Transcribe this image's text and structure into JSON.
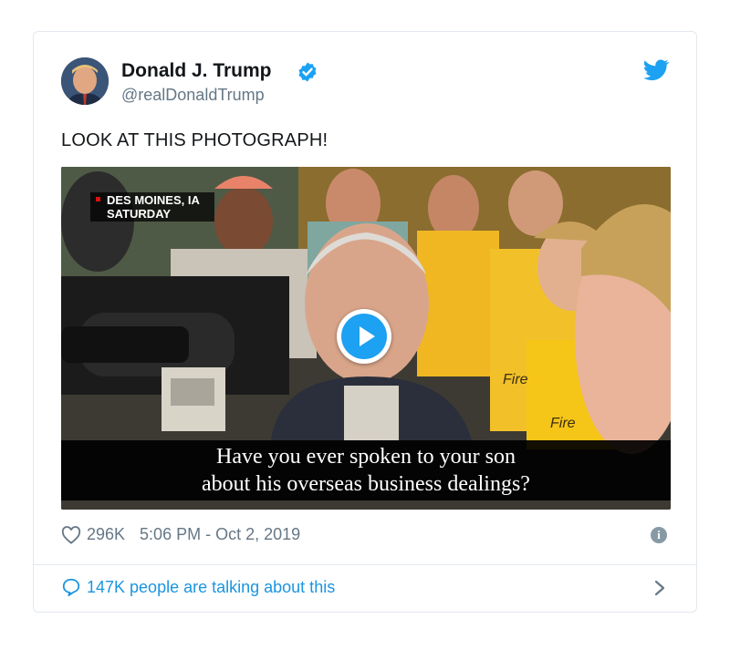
{
  "tweet": {
    "author_name": "Donald J. Trump",
    "handle": "@realDonaldTrump",
    "text": "LOOK AT THIS PHOTOGRAPH!",
    "likes": "296K",
    "timestamp": "5:06 PM - Oct 2, 2019",
    "talking": "147K people are talking about this"
  },
  "video": {
    "locator_line1": "DES MOINES, IA",
    "locator_line2": "SATURDAY",
    "caption_line1": "Have you ever spoken to your son",
    "caption_line2": "about his overseas business dealings?",
    "vest_text_1": "Fire",
    "vest_text_2": "Fire"
  },
  "icons": {
    "verified": "verified-badge-icon",
    "bird": "twitter-bird-icon",
    "heart": "heart-icon",
    "info": "info-icon",
    "bubble": "comment-bubble-icon",
    "chevron": "chevron-right-icon",
    "play": "play-icon"
  },
  "colors": {
    "accent": "#1da1f2",
    "link": "#1b95e0",
    "muted": "#657786",
    "vest_yellow": "#f5c518"
  }
}
